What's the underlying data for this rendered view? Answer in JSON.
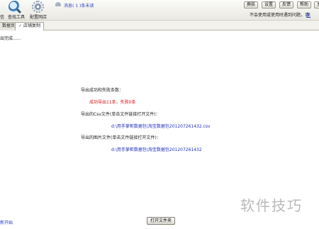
{
  "toolbar": {
    "labels": [
      "信",
      "查找工具",
      "配置网店"
    ],
    "message": "消息( 1 )条未读",
    "buttons": [
      "换肤",
      "设置",
      "反馈",
      "帮助",
      "关"
    ],
    "hint": "不会使用或使用时遇到问题，请",
    "hint_link": "联"
  },
  "tabs": [
    "数据页",
    "店铺复制"
  ],
  "content": {
    "status_top": "出完成......",
    "heading": "导出成功和失败条数：",
    "result": "成功导出11条，失败0条",
    "csv_label": "导出的Csv文件(单击文件链接打开文件)：",
    "csv_link": "d:\\用手掌柜数据包\\淘宝数据包201207261432.csv",
    "img_label": "导出的图片文件(单击文件链接打开文件)：",
    "img_link": "d:\\用手掌柜数据包\\淘宝数据包201207261432"
  },
  "bottom": {
    "restart": "新开始",
    "open_button": "打开文件夹"
  },
  "watermark": "软件技巧"
}
